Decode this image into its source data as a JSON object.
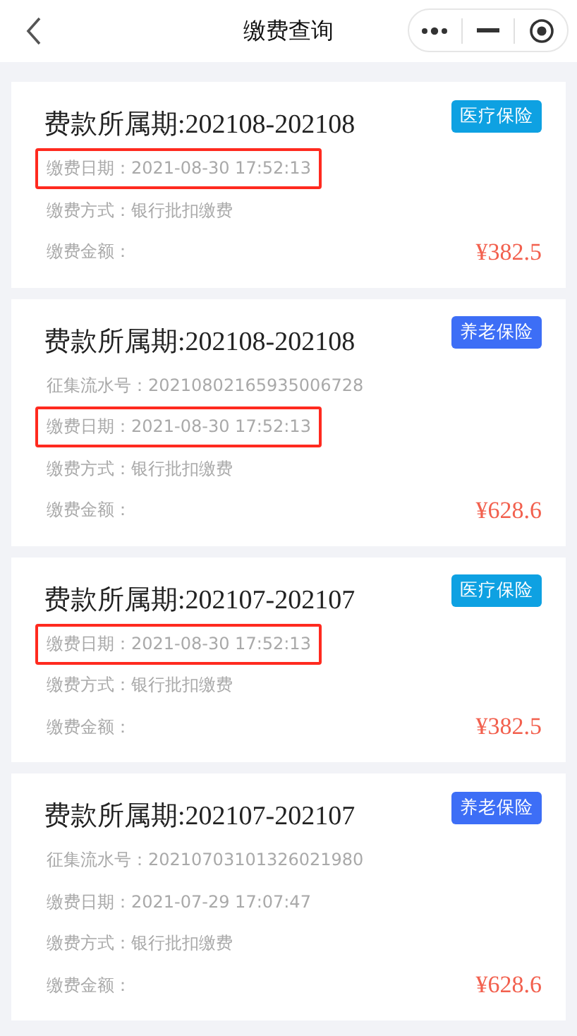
{
  "header": {
    "title": "缴费查询"
  },
  "records": [
    {
      "title": "费款所属期:202108-202108",
      "tag": {
        "label": "医疗保险",
        "color": "#0ea1e2"
      },
      "rows": [
        {
          "text": "缴费日期：2021-08-30 17:52:13",
          "highlighted": true
        },
        {
          "text": "缴费方式：银行批扣缴费",
          "highlighted": false
        }
      ],
      "amount_label": "缴费金额：",
      "amount": "¥382.5"
    },
    {
      "title": "费款所属期:202108-202108",
      "tag": {
        "label": "养老保险",
        "color": "#3d6ef6"
      },
      "rows": [
        {
          "text": "征集流水号：20210802165935006728",
          "highlighted": false
        },
        {
          "text": "缴费日期：2021-08-30 17:52:13",
          "highlighted": true
        },
        {
          "text": "缴费方式：银行批扣缴费",
          "highlighted": false
        }
      ],
      "amount_label": "缴费金额：",
      "amount": "¥628.6"
    },
    {
      "title": "费款所属期:202107-202107",
      "tag": {
        "label": "医疗保险",
        "color": "#0ea1e2"
      },
      "rows": [
        {
          "text": "缴费日期：2021-08-30 17:52:13",
          "highlighted": true
        },
        {
          "text": "缴费方式：银行批扣缴费",
          "highlighted": false
        }
      ],
      "amount_label": "缴费金额：",
      "amount": "¥382.5"
    },
    {
      "title": "费款所属期:202107-202107",
      "tag": {
        "label": "养老保险",
        "color": "#3d6ef6"
      },
      "rows": [
        {
          "text": "征集流水号：20210703101326021980",
          "highlighted": false
        },
        {
          "text": "缴费日期：2021-07-29 17:07:47",
          "highlighted": false
        },
        {
          "text": "缴费方式：银行批扣缴费",
          "highlighted": false
        }
      ],
      "amount_label": "缴费金额：",
      "amount": "¥628.6"
    }
  ]
}
